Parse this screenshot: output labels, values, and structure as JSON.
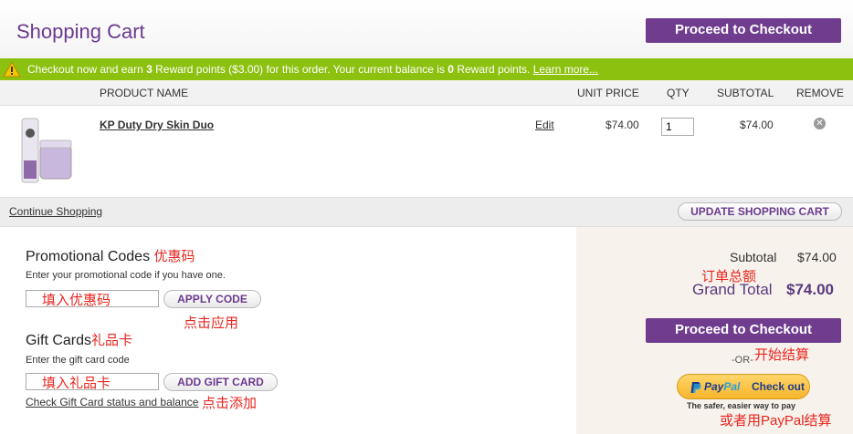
{
  "header": {
    "title": "Shopping Cart",
    "checkout_label": "Proceed to Checkout"
  },
  "reward": {
    "prefix": "Checkout now and earn ",
    "points": "3",
    "middle": " Reward points ($3.00) for this order. Your current balance is ",
    "balance": "0",
    "suffix": " Reward points.",
    "link": "Learn more..."
  },
  "table": {
    "headers": {
      "product_name": "PRODUCT NAME",
      "unit_price": "UNIT PRICE",
      "qty": "QTY",
      "subtotal": "SUBTOTAL",
      "remove": "REMOVE"
    },
    "rows": [
      {
        "name": "KP Duty Dry Skin Duo",
        "edit": "Edit",
        "unit_price": "$74.00",
        "qty": "1",
        "subtotal": "$74.00",
        "remove_icon": "remove-x-icon"
      }
    ]
  },
  "actions": {
    "continue": "Continue Shopping",
    "update": "UPDATE SHOPPING CART"
  },
  "promo": {
    "title": "Promotional Codes",
    "title_annot": "优惠码",
    "hint": "Enter your promotional code if you have one.",
    "placeholder": "填入优惠码",
    "button": "APPLY CODE",
    "button_annot": "点击应用"
  },
  "gift": {
    "title": "Gift Cards",
    "title_annot": "礼品卡",
    "hint": "Enter the gift card code",
    "placeholder": "填入礼品卡",
    "button": "ADD GIFT CARD",
    "link": "Check Gift Card status and balance",
    "link_annot": "点击添加"
  },
  "summary": {
    "subtotal_label": "Subtotal",
    "subtotal_value": "$74.00",
    "subtotal_annot": "订单总额",
    "grand_label": "Grand Total",
    "grand_value": "$74.00",
    "checkout_label": "Proceed to Checkout",
    "or_text": "-OR-",
    "checkout_annot": "开始结算",
    "paypal_pay": "Pay",
    "paypal_pal": "Pal",
    "paypal_checkout": "Check out",
    "paypal_tagline": "The safer, easier way to pay",
    "paypal_annot": "或者用PayPal结算"
  },
  "colors": {
    "brand_purple": "#6f3c8e",
    "reward_green": "#8cc10f",
    "annotation_red": "#e8261f",
    "summary_bg": "#f7f2ec"
  }
}
